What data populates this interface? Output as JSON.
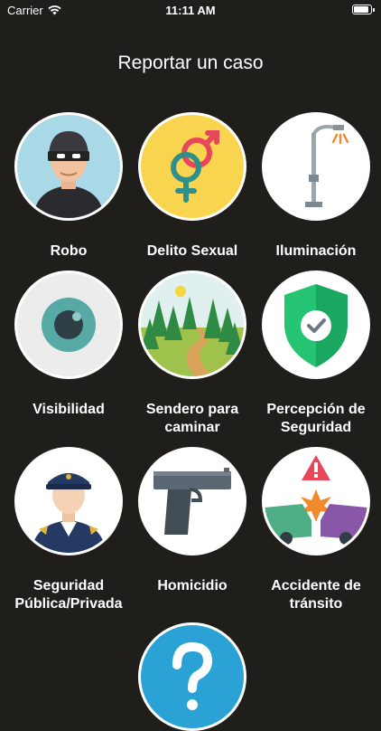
{
  "status": {
    "carrier": "Carrier",
    "time": "11:11 AM"
  },
  "title": "Reportar un caso",
  "categories": [
    {
      "label": "Robo",
      "icon": "robber-icon"
    },
    {
      "label": "Delito Sexual",
      "icon": "gender-symbols-icon"
    },
    {
      "label": "Iluminación",
      "icon": "street-lamp-icon"
    },
    {
      "label": "Visibilidad",
      "icon": "eye-icon"
    },
    {
      "label": "Sendero para caminar",
      "icon": "forest-path-icon"
    },
    {
      "label": "Percepción de Seguridad",
      "icon": "shield-check-icon"
    },
    {
      "label": "Seguridad Pública/Privada",
      "icon": "police-officer-icon"
    },
    {
      "label": "Homicidio",
      "icon": "pistol-icon"
    },
    {
      "label": "Accidente de tránsito",
      "icon": "car-crash-icon"
    },
    {
      "label": "",
      "icon": "question-icon"
    }
  ]
}
